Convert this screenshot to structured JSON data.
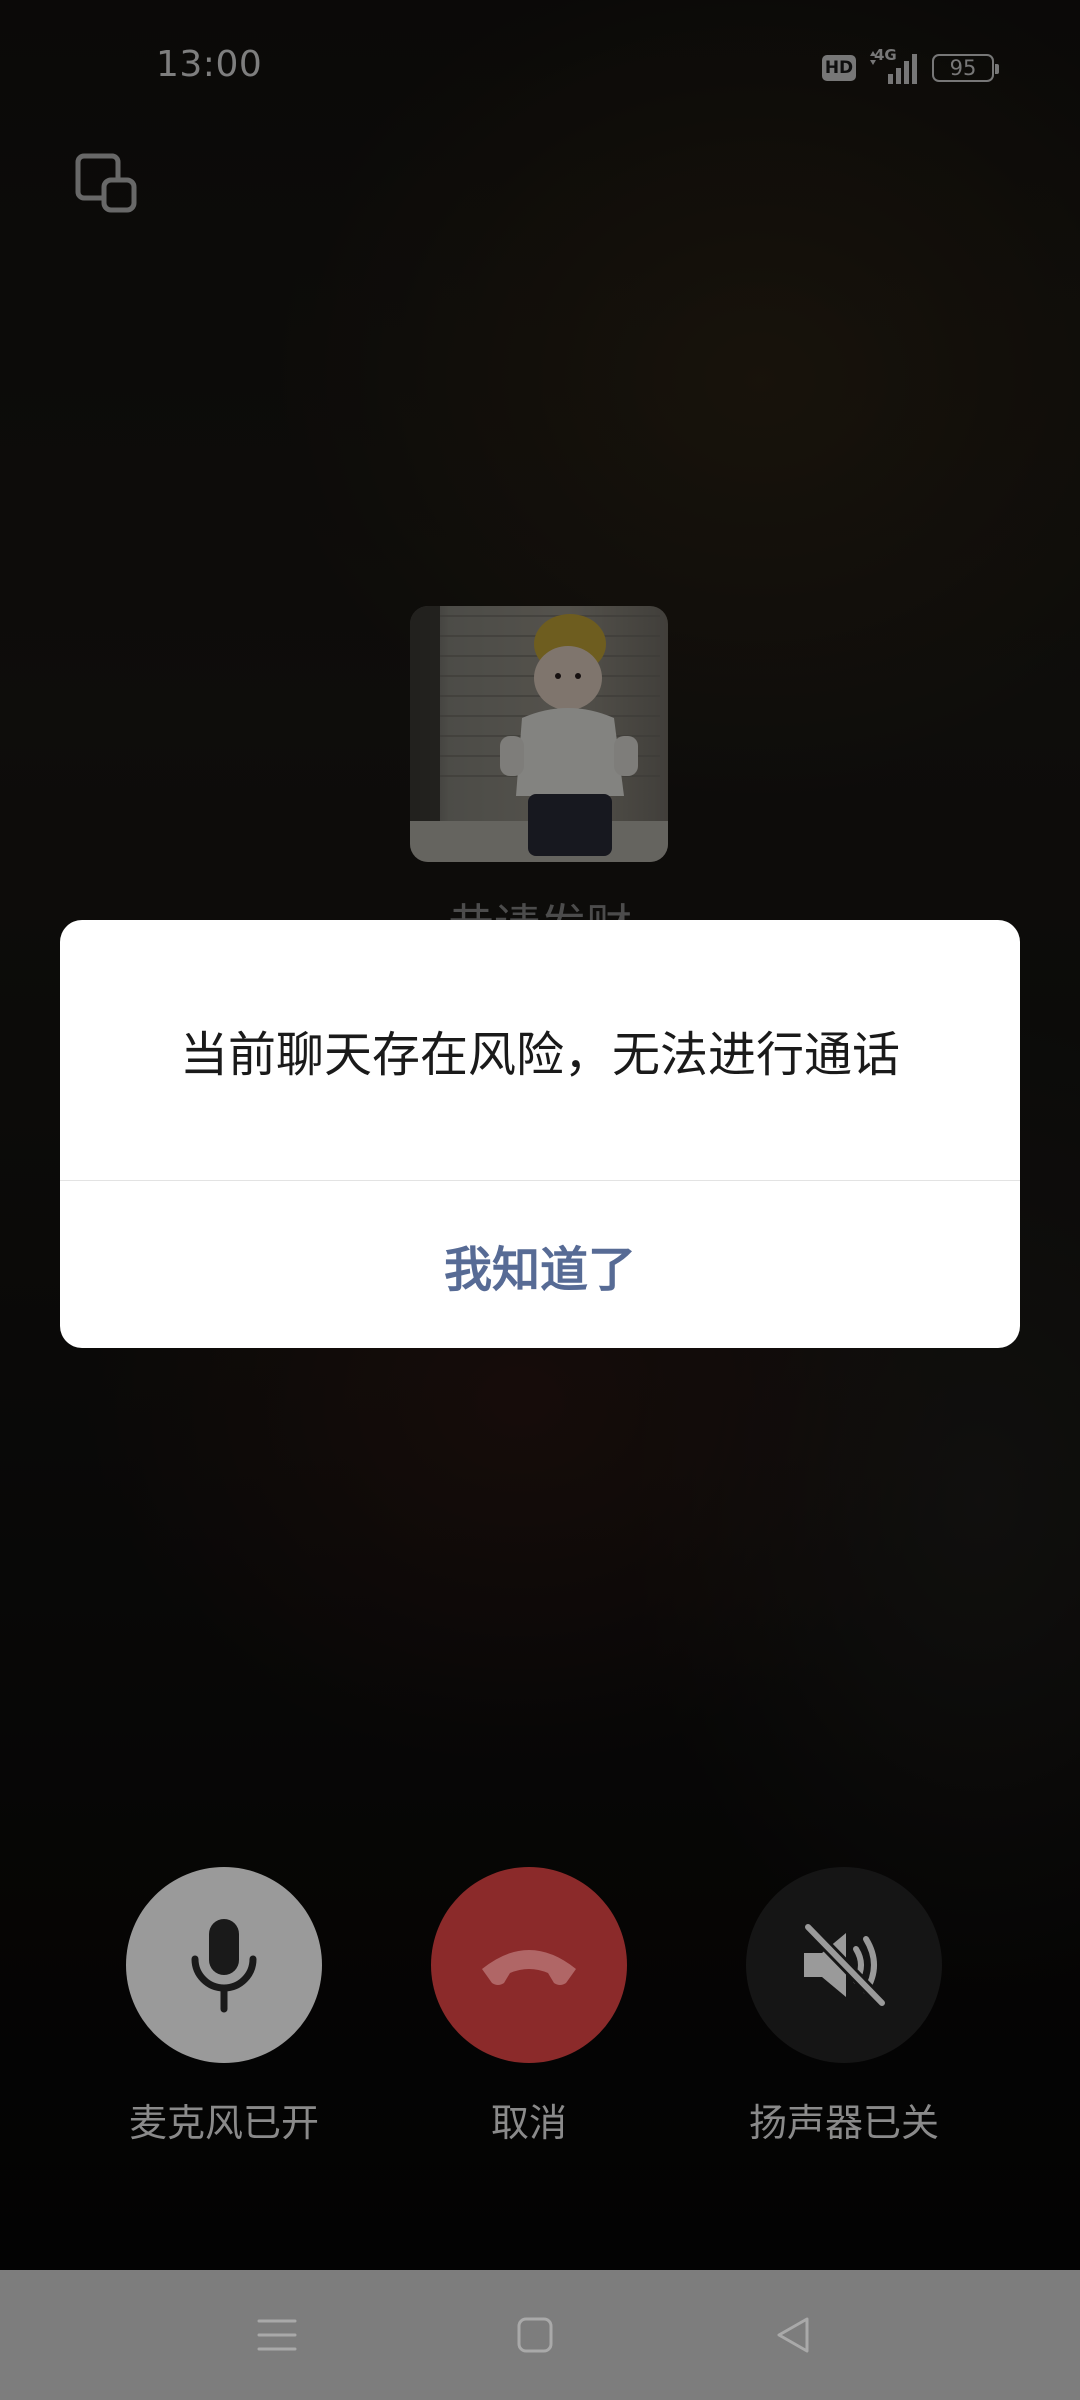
{
  "status_bar": {
    "time": "13:00",
    "hd_label": "HD",
    "network_label": "4G",
    "battery_level": "95"
  },
  "call": {
    "contact_name": "恭请发财",
    "avatar_icon": "contact-avatar-photo"
  },
  "dialog": {
    "message": "当前聊天存在风险，无法进行通话",
    "confirm_label": "我知道了",
    "accent_color": "#576b95"
  },
  "controls": {
    "mic_label": "麦克风已开",
    "cancel_label": "取消",
    "speaker_label": "扬声器已关",
    "mic_icon": "microphone-icon",
    "hangup_icon": "phone-hangup-icon",
    "speaker_icon": "speaker-muted-icon",
    "hangup_color": "#8b2a2a"
  },
  "nav_bar": {
    "menu_icon": "menu-icon",
    "home_icon": "home-icon",
    "back_icon": "back-icon"
  }
}
